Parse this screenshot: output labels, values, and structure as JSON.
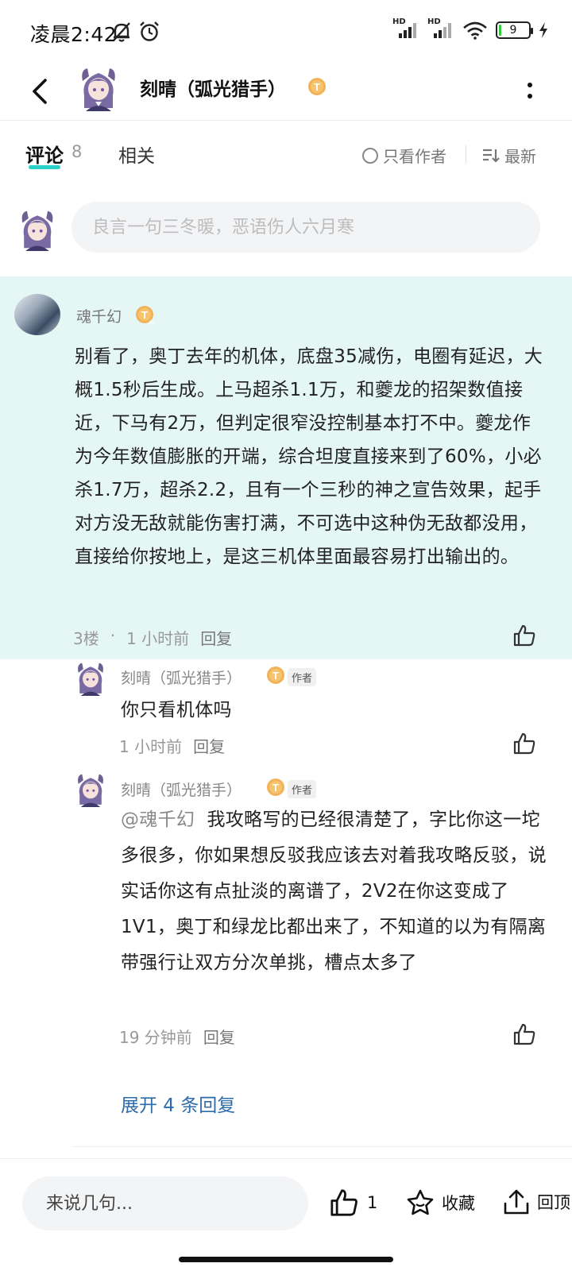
{
  "status_bar": {
    "time": "凌晨2:42",
    "battery": "9",
    "signal1_label": "HD",
    "signal2_label": "HD"
  },
  "header": {
    "title": "刻晴（弧光猎手）",
    "badge_letter": "T"
  },
  "tabs": {
    "comments_label": "评论",
    "comments_count": "8",
    "related_label": "相关",
    "author_only_label": "只看作者",
    "sort_label": "最新"
  },
  "comment_input": {
    "placeholder": "良言一句三冬暖，恶语伤人六月寒"
  },
  "main_comment": {
    "username": "魂千幻",
    "text": "别看了，奥丁去年的机体，底盘35减伤，电圈有延迟，大概1.5秒后生成。上马超杀1.1万，和夔龙的招架数值接近，下马有2万，但判定很窄没控制基本打不中。夔龙作为今年数值膨胀的开端，综合坦度直接来到了60%，小必杀1.7万，超杀2.2，且有一个三秒的神之宣告效果，起手对方没无敌就能伤害打满，不可选中这种伪无敌都没用，直接给你按地上，是这三机体里面最容易打出输出的。",
    "floor": "3楼",
    "dot": "·",
    "time": "1 小时前",
    "reply_label": "回复"
  },
  "replies": [
    {
      "username": "刻晴（弧光猎手）",
      "author_tag": "作者",
      "text": "你只看机体吗",
      "time": "1 小时前",
      "reply_label": "回复"
    },
    {
      "username": "刻晴（弧光猎手）",
      "author_tag": "作者",
      "mention": "@魂千幻",
      "text": "我攻略写的已经很清楚了，字比你这一坨多很多，你如果想反驳我应该去对着我攻略反驳，说实话你这有点扯淡的离谱了，2V2在你这变成了1V1，奥丁和绿龙比都出来了，不知道的以为有隔离带强行让双方分次单挑，槽点太多了",
      "time": "19 分钟前",
      "reply_label": "回复"
    }
  ],
  "expand_label": "展开 4 条回复",
  "bottom_bar": {
    "input_placeholder": "来说几句...",
    "like_count": "1",
    "favorite_label": "收藏",
    "back_top_label": "回顶"
  },
  "colors": {
    "accent": "#2bd1c6",
    "highlight_bg": "#e5f7f4",
    "link": "#2e6ba8",
    "coin": "#f5a623"
  },
  "icons": [
    "back-arrow-icon",
    "more-icon",
    "mute-bell-icon",
    "alarm-icon",
    "signal-icon",
    "wifi-icon",
    "battery-icon",
    "charging-icon",
    "sort-icon",
    "thumb-up-icon",
    "star-icon",
    "upload-icon",
    "coin-badge-icon"
  ]
}
